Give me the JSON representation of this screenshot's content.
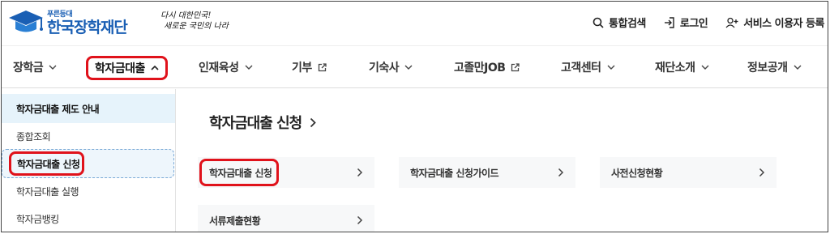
{
  "header": {
    "logo_sub": "푸른등대",
    "logo_main": "한국장학재단",
    "slogan_line1": "다시 대한민국!",
    "slogan_line2": "새로운 국민의 나라",
    "utils": [
      {
        "label": "통합검색",
        "icon": "search-icon"
      },
      {
        "label": "로그인",
        "icon": "login-icon"
      },
      {
        "label": "서비스 이용자 등록",
        "icon": "user-add-icon"
      }
    ]
  },
  "gnb": {
    "items": [
      {
        "label": "장학금",
        "icon": "chevron-down-icon"
      },
      {
        "label": "학자금대출",
        "icon": "chevron-up-icon",
        "active": true
      },
      {
        "label": "인재육성",
        "icon": "chevron-down-icon"
      },
      {
        "label": "기부",
        "icon": "external-link-icon"
      },
      {
        "label": "기숙사",
        "icon": "chevron-down-icon"
      },
      {
        "label": "고졸만JOB",
        "icon": "external-link-icon"
      },
      {
        "label": "고객센터",
        "icon": "chevron-down-icon"
      },
      {
        "label": "재단소개",
        "icon": "chevron-down-icon"
      },
      {
        "label": "정보공개",
        "icon": "chevron-down-icon"
      }
    ]
  },
  "sidebar": {
    "items": [
      {
        "label": "학자금대출 제도 안내"
      },
      {
        "label": "종합조회"
      },
      {
        "label": "학자금대출 신청"
      },
      {
        "label": "학자금대출 실행"
      },
      {
        "label": "학자금뱅킹"
      }
    ]
  },
  "main": {
    "title": "학자금대출 신청",
    "cards": [
      {
        "label": "학자금대출 신청"
      },
      {
        "label": "학자금대출 신청가이드"
      },
      {
        "label": "사전신청현황"
      },
      {
        "label": "서류제출현황"
      }
    ]
  },
  "colors": {
    "brand": "#1a5fb4",
    "highlight": "#e0121b",
    "sidebar_selected": "#e6f3fb"
  }
}
